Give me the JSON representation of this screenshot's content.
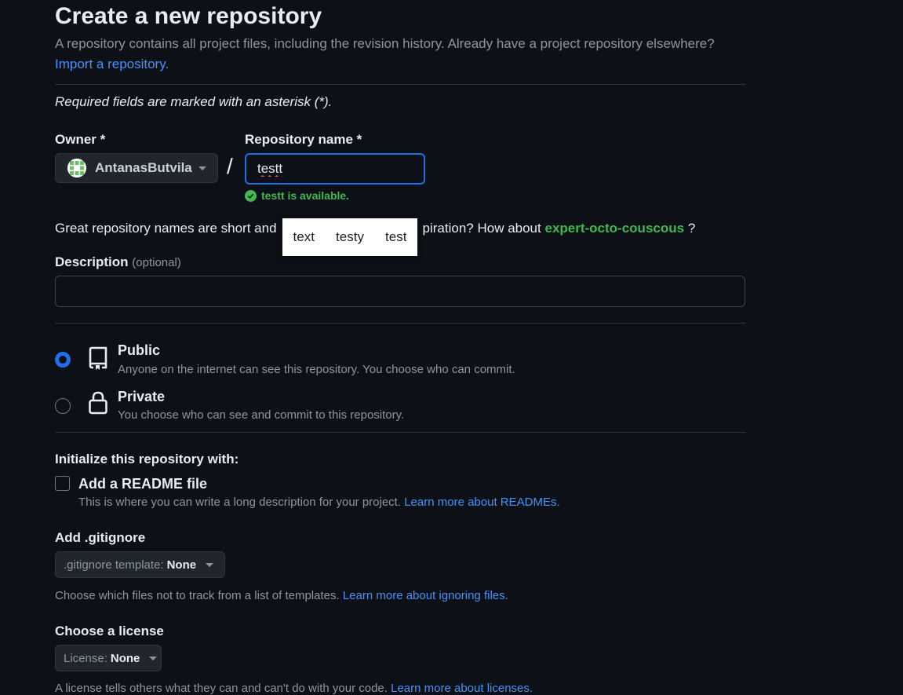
{
  "header": {
    "title": "Create a new repository",
    "subtitle": "A repository contains all project files, including the revision history. Already have a project repository elsewhere?",
    "import_link": "Import a repository."
  },
  "required_note": "Required fields are marked with an asterisk (*).",
  "owner": {
    "label": "Owner *",
    "value": "AntanasButvila"
  },
  "separator": "/",
  "repo_name": {
    "label": "Repository name *",
    "value": "testt",
    "availability": "testt is available."
  },
  "suggestion": {
    "prefix": "Great repository names are short and",
    "middle": "piration? How about",
    "name": "expert-octo-couscous",
    "suffix": "?"
  },
  "spellcheck": {
    "options": [
      "text",
      "testy",
      "test"
    ]
  },
  "description": {
    "label": "Description",
    "optional": "(optional)",
    "value": ""
  },
  "visibility": {
    "public": {
      "label": "Public",
      "desc": "Anyone on the internet can see this repository. You choose who can commit.",
      "selected": true
    },
    "private": {
      "label": "Private",
      "desc": "You choose who can see and commit to this repository.",
      "selected": false
    }
  },
  "init": {
    "heading": "Initialize this repository with:",
    "readme_label": "Add a README file",
    "readme_desc": "This is where you can write a long description for your project.",
    "readme_link": "Learn more about READMEs.",
    "readme_checked": false
  },
  "gitignore": {
    "heading": "Add .gitignore",
    "key": ".gitignore template:",
    "value": "None",
    "desc": "Choose which files not to track from a list of templates.",
    "link": "Learn more about ignoring files."
  },
  "license": {
    "heading": "Choose a license",
    "key": "License:",
    "value": "None",
    "desc": "A license tells others what they can and can't do with your code.",
    "link": "Learn more about licenses."
  },
  "colors": {
    "background": "#0d1117",
    "accent": "#1f6feb",
    "link": "#4493f8",
    "success": "#3fb950",
    "muted": "#8d96a0"
  },
  "icons": {
    "owner_avatar": "identicon-avatar",
    "availability": "check-circle-icon",
    "public": "repo-book-icon",
    "private": "lock-icon",
    "dropdown": "caret-down-icon"
  }
}
